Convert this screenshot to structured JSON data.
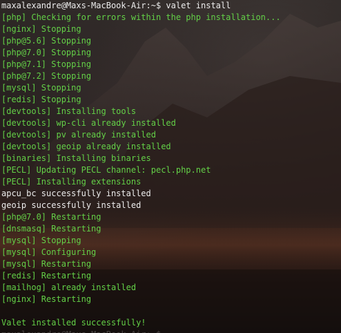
{
  "terminal": {
    "prompt": "maxalexandre@Maxs-MacBook-Air:~$",
    "command": "valet install",
    "lines": [
      {
        "text": "[php] Checking for errors within the php installation...",
        "color": "green"
      },
      {
        "text": "[nginx] Stopping",
        "color": "green"
      },
      {
        "text": "[php@5.6] Stopping",
        "color": "green"
      },
      {
        "text": "[php@7.0] Stopping",
        "color": "green"
      },
      {
        "text": "[php@7.1] Stopping",
        "color": "green"
      },
      {
        "text": "[php@7.2] Stopping",
        "color": "green"
      },
      {
        "text": "[mysql] Stopping",
        "color": "green"
      },
      {
        "text": "[redis] Stopping",
        "color": "green"
      },
      {
        "text": "[devtools] Installing tools",
        "color": "green"
      },
      {
        "text": "[devtools] wp-cli already installed",
        "color": "green"
      },
      {
        "text": "[devtools] pv already installed",
        "color": "green"
      },
      {
        "text": "[devtools] geoip already installed",
        "color": "green"
      },
      {
        "text": "[binaries] Installing binaries",
        "color": "green"
      },
      {
        "text": "[PECL] Updating PECL channel: pecl.php.net",
        "color": "green"
      },
      {
        "text": "[PECL] Installing extensions",
        "color": "green"
      },
      {
        "text": "apcu_bc successfully installed",
        "color": "white"
      },
      {
        "text": "geoip successfully installed",
        "color": "white"
      },
      {
        "text": "[php@7.0] Restarting",
        "color": "green"
      },
      {
        "text": "[dnsmasq] Restarting",
        "color": "green"
      },
      {
        "text": "[mysql] Stopping",
        "color": "green"
      },
      {
        "text": "[mysql] Configuring",
        "color": "green"
      },
      {
        "text": "[mysql] Restarting",
        "color": "green"
      },
      {
        "text": "[redis] Restarting",
        "color": "green"
      },
      {
        "text": "[mailhog] already installed",
        "color": "green"
      },
      {
        "text": "[nginx] Restarting",
        "color": "green"
      },
      {
        "text": "",
        "color": "green"
      },
      {
        "text": "Valet installed successfully!",
        "color": "green"
      }
    ]
  },
  "colors": {
    "green": "#63d047",
    "white": "#ececec"
  }
}
